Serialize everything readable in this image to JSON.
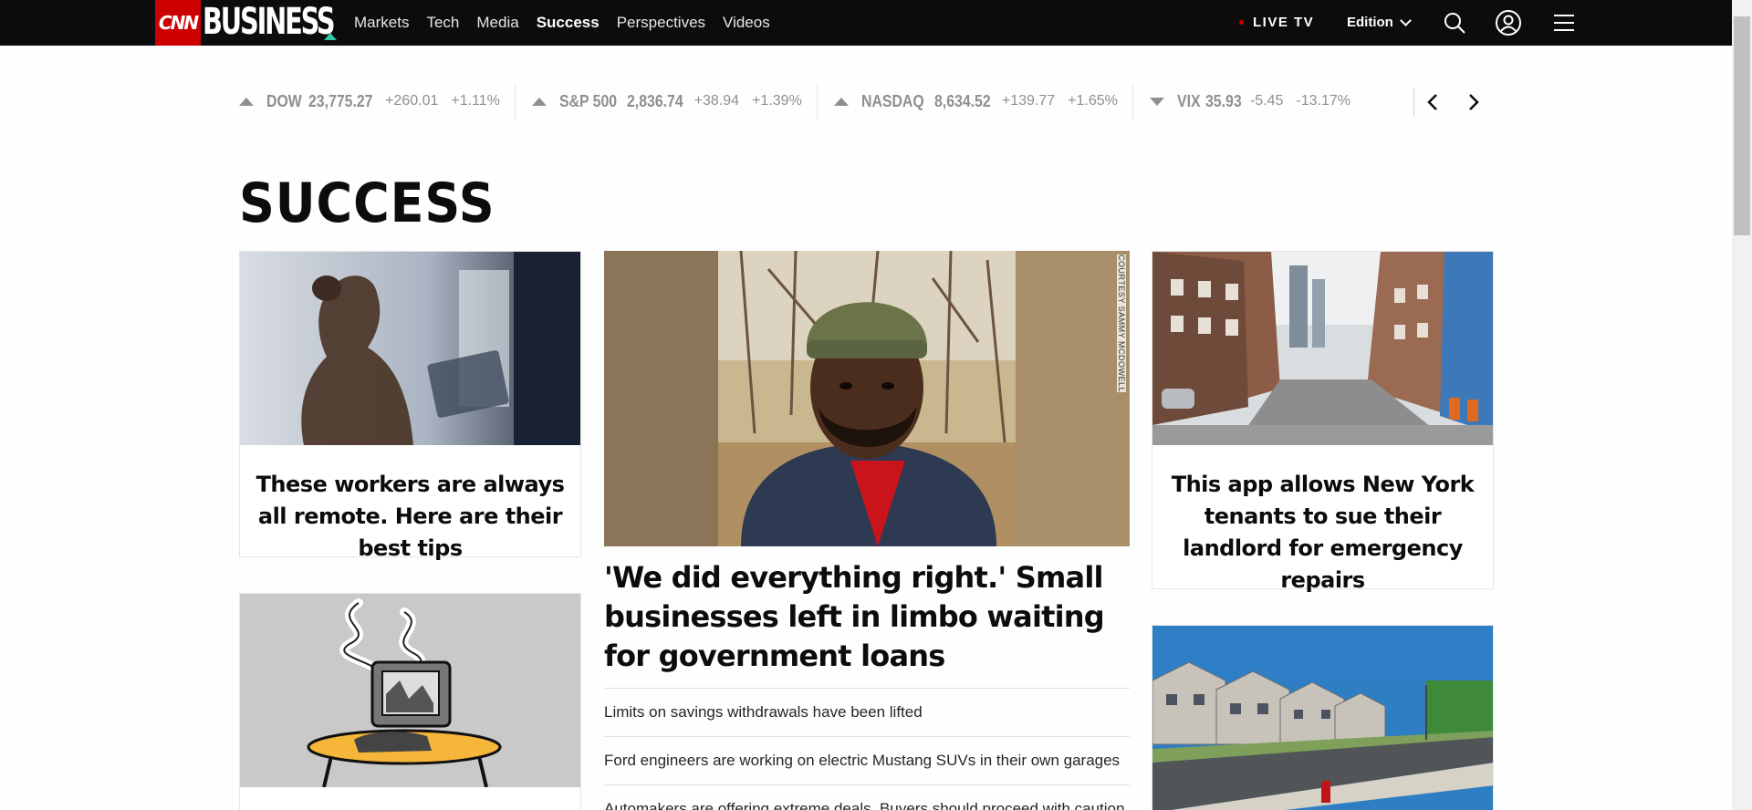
{
  "header": {
    "logo_cnn": "CNN",
    "logo_business": "BUSINESS",
    "nav": [
      "Markets",
      "Tech",
      "Media",
      "Success",
      "Perspectives",
      "Videos"
    ],
    "active_nav": "Success",
    "live_tv": "LIVE TV",
    "edition": "Edition",
    "colors": {
      "bar": "#0c0c0c",
      "brand_red": "#cc0000",
      "accent": "#2cc7a6"
    },
    "icons": [
      "search-icon",
      "user-icon",
      "menu-icon"
    ]
  },
  "ticker": [
    {
      "name": "DOW",
      "value": "23,775.27",
      "change": "+260.01",
      "pct": "+1.11%",
      "direction": "up"
    },
    {
      "name": "S&P 500",
      "value": "2,836.74",
      "change": "+38.94",
      "pct": "+1.39%",
      "direction": "up"
    },
    {
      "name": "NASDAQ",
      "value": "8,634.52",
      "change": "+139.77",
      "pct": "+1.65%",
      "direction": "up"
    },
    {
      "name": "VIX",
      "value": "35.93",
      "change": "-5.45",
      "pct": "-13.17%",
      "direction": "down"
    }
  ],
  "page_title": "SUCCESS",
  "cards": {
    "left_top": {
      "headline": "These workers are always all remote. Here are their best tips"
    },
    "right_top": {
      "headline": "This app allows New York tenants to sue their landlord for emergency repairs"
    }
  },
  "main": {
    "credit": "COURTESY SAMMY MCDOWELL",
    "headline": "'We did everything right.' Small businesses left in limbo waiting for government loans",
    "related": [
      "Limits on savings withdrawals have been lifted",
      "Ford engineers are working on electric Mustang SUVs in their own garages",
      "Automakers are offering extreme deals. Buyers should proceed with caution"
    ]
  }
}
